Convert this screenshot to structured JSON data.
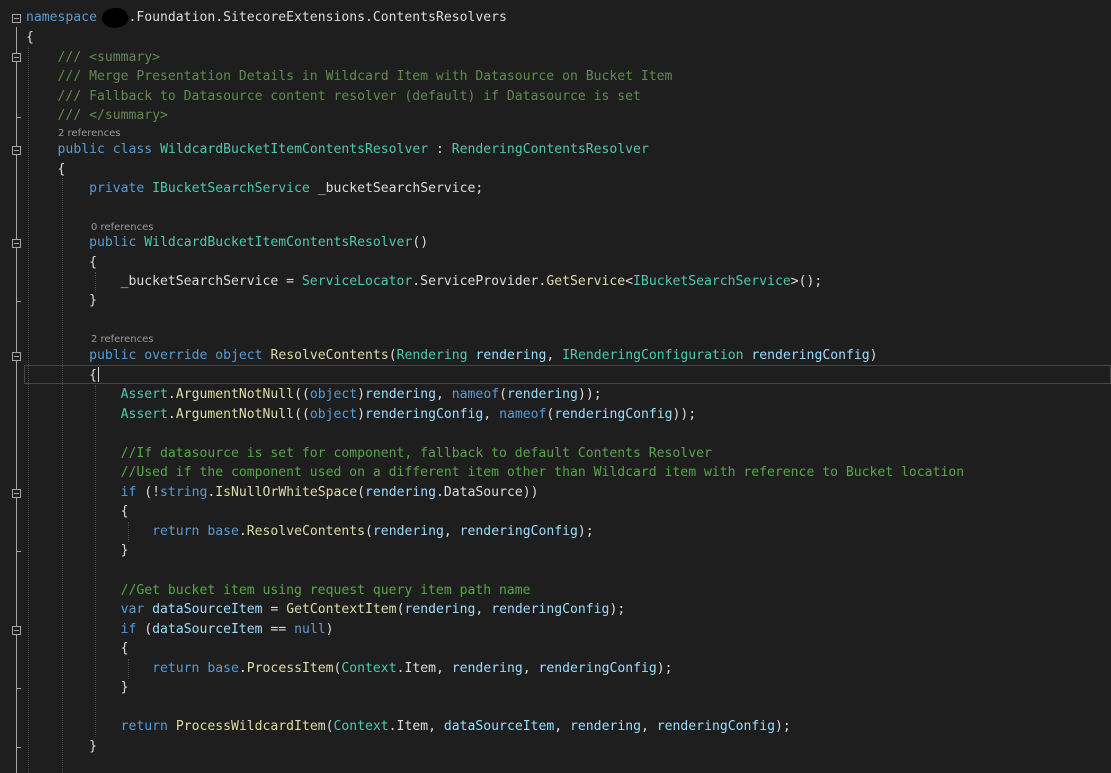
{
  "code": {
    "namespace_kw": "namespace",
    "namespace_name": ".Foundation.SitecoreExtensions.ContentsResolvers",
    "open_brace": "{",
    "close_brace": "}",
    "summary_open": "/// <summary>",
    "summary_line1": "/// Merge Presentation Details in Wildcard Item with Datasource on Bucket Item",
    "summary_line2": "/// Fallback to Datasource content resolver (default) if Datasource is set",
    "summary_close": "/// </summary>",
    "class_refs": "2 references",
    "public_kw": "public",
    "class_kw": "class",
    "class_name": "WildcardBucketItemContentsResolver",
    "colon": " : ",
    "base_class": "RenderingContentsResolver",
    "private_kw": "private",
    "field_type": "IBucketSearchService",
    "field_name": "_bucketSearchService;",
    "ctor_refs": "0 references",
    "ctor_name": "WildcardBucketItemContentsResolver",
    "empty_parens": "()",
    "assign_target": "_bucketSearchService = ",
    "service_locator": "ServiceLocator",
    "service_provider": ".ServiceProvider.",
    "get_service": "GetService",
    "generic_open": "<",
    "search_service_type": "IBucketSearchService",
    "generic_close_call": ">();",
    "method_refs": "2 references",
    "override_kw": "override",
    "object_kw": "object",
    "method_name": "ResolveContents",
    "rendering_type": "Rendering",
    "rendering_param": "rendering",
    "rendering_config_type": "IRenderingConfiguration",
    "rendering_config_param": "renderingConfig",
    "assert_type": "Assert",
    "argument_not_null": "ArgumentNotNull",
    "nameof_kw": "nameof",
    "comment_datasource": "//If datasource is set for component, fallback to default Contents Resolver",
    "comment_used_if": "//Used if the component used on a different item other than Wildcard item with reference to Bucket location",
    "if_kw": "if",
    "string_kw": "string",
    "is_null_or_ws": "IsNullOrWhiteSpace",
    "datasource_prop": ".DataSource",
    "return_kw": "return",
    "base_kw": "base",
    "comment_get_bucket": "//Get bucket item using request query item path name",
    "var_kw": "var",
    "datasource_item_var": "dataSourceItem",
    "get_context_item": "GetContextItem",
    "null_kw": "null",
    "process_item": "ProcessItem",
    "context_type": "Context",
    "item_prop": ".Item",
    "process_wildcard_item": "ProcessWildcardItem"
  },
  "colors": {
    "background": "#1e1e1e",
    "keyword": "#569cd6",
    "type": "#4ec9b0",
    "comment": "#57a64a",
    "method": "#dcdcaa",
    "parameter": "#9cdcfe",
    "text": "#dcdcdc"
  }
}
